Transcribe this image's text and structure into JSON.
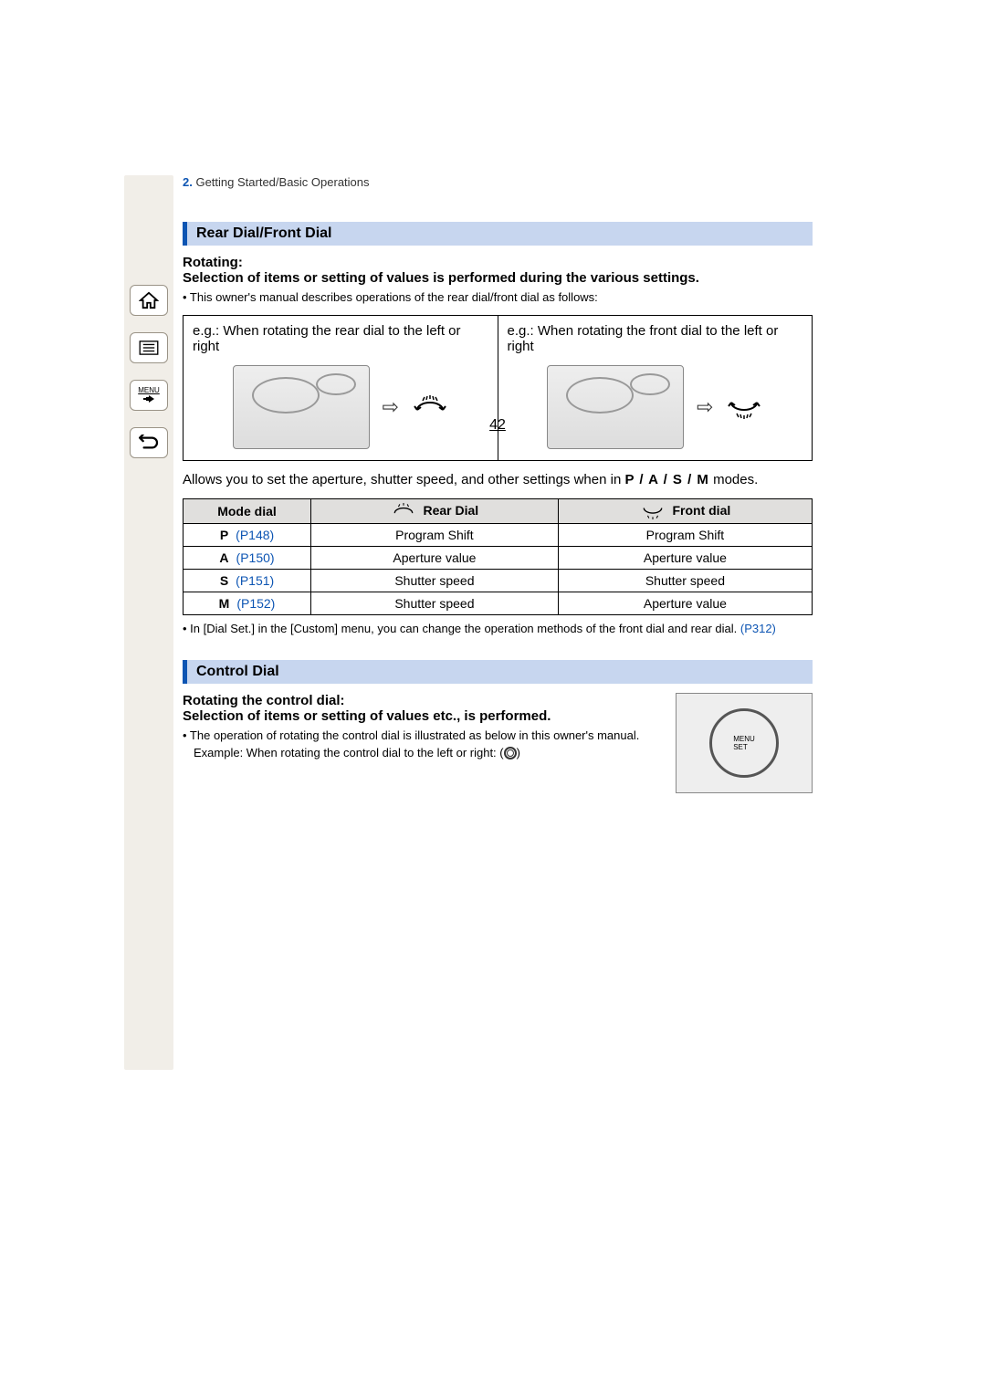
{
  "breadcrumb": {
    "num": "2.",
    "text": "Getting Started/Basic Operations"
  },
  "section1": {
    "title": "Rear Dial/Front Dial",
    "rotating_label": "Rotating:",
    "rotating_desc": "Selection of items or setting of values is performed during the various settings.",
    "owners_note": "• This owner's manual describes operations of the rear dial/front dial as follows:",
    "col_left": "e.g.: When rotating the rear dial to the left or right",
    "col_right": "e.g.: When rotating the front dial to the left or right",
    "modes_pre": "Allows you to set the aperture, shutter speed, and other settings when in ",
    "modes_letters": "P / A / S / M",
    "modes_post": " modes.",
    "table": {
      "headers": {
        "mode": "Mode dial",
        "rear": "Rear Dial",
        "front": "Front dial"
      },
      "rows": [
        {
          "letter": "P",
          "pref": "(P148)",
          "rear": "Program Shift",
          "front": "Program Shift"
        },
        {
          "letter": "A",
          "pref": "(P150)",
          "rear": "Aperture value",
          "front": "Aperture value"
        },
        {
          "letter": "S",
          "pref": "(P151)",
          "rear": "Shutter speed",
          "front": "Shutter speed"
        },
        {
          "letter": "M",
          "pref": "(P152)",
          "rear": "Shutter speed",
          "front": "Aperture value"
        }
      ]
    },
    "dial_note_pre": "• In [Dial Set.] in the [Custom] menu, you can change the operation methods of the front dial and rear dial. ",
    "dial_note_link": "(P312)"
  },
  "section2": {
    "title": "Control Dial",
    "heading1": "Rotating the control dial:",
    "heading2": "Selection of items or setting of values etc., is performed.",
    "bullet": "• The operation of rotating the control dial is illustrated as below in this owner's manual.",
    "example_pre": "Example: When rotating the control dial to the left or right: "
  },
  "nav": {
    "menu_label": "MENU"
  },
  "page_number": "42"
}
